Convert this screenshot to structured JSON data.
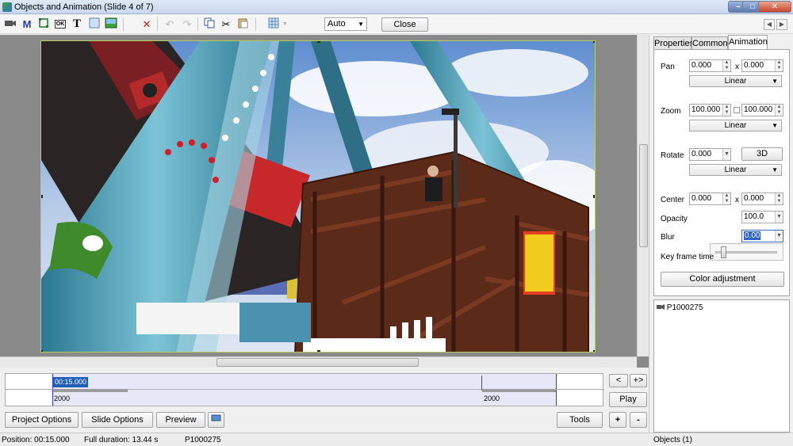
{
  "window": {
    "title": "Objects and Animation  (Slide 4 of 7)",
    "min_glyph": "–",
    "max_glyph": "□",
    "close_glyph": "✕"
  },
  "toolbar": {
    "zoom_value": "Auto",
    "close_label": "Close",
    "icons": [
      "camera-icon",
      "mask-icon",
      "frame-icon",
      "button-icon",
      "text-icon",
      "rectangle-icon",
      "image-icon",
      "delete-icon",
      "undo-icon",
      "redo-icon",
      "copy-icon",
      "cut-icon",
      "paste-icon",
      "grid-icon"
    ],
    "text_glyph": "T",
    "mask_glyph": "M",
    "button_glyph": "OK",
    "delete_glyph": "✕",
    "undo_glyph": "↶",
    "redo_glyph": "↷",
    "cut_glyph": "✂"
  },
  "tabs": [
    {
      "label": "Properties"
    },
    {
      "label": "Common"
    },
    {
      "label": "Animation"
    }
  ],
  "animation": {
    "pan": {
      "label": "Pan",
      "x": "0.000",
      "y": "0.000",
      "sep": "x",
      "mode": "Linear"
    },
    "zoom": {
      "label": "Zoom",
      "x": "100.000",
      "y": "100.000",
      "mode": "Linear"
    },
    "rotate": {
      "label": "Rotate",
      "value": "0.000",
      "btn3d": "3D",
      "mode": "Linear"
    },
    "center": {
      "label": "Center",
      "x": "0.000",
      "y": "0.000",
      "sep": "x"
    },
    "opacity": {
      "label": "Opacity",
      "value": "100.0"
    },
    "blur": {
      "label": "Blur",
      "value": "0.00"
    },
    "keyframe": {
      "label": "Key frame time",
      "slider_fraction": 0.1
    },
    "color_adjustment": "Color adjustment"
  },
  "objects_list": {
    "items": [
      {
        "name": "P1000275"
      }
    ]
  },
  "timeline": {
    "current_time": "00:15.000",
    "marker_left": "2000",
    "marker_right": "2000"
  },
  "nav": {
    "prev": "<",
    "next": "+>",
    "play": "Play",
    "add": "+",
    "remove": "-",
    "left_arrow": "◀",
    "right_arrow": "▶"
  },
  "buttons": {
    "project_options": "Project Options",
    "slide_options": "Slide Options",
    "preview": "Preview",
    "tools": "Tools"
  },
  "status": {
    "position": "Position:  00:15.000",
    "duration": "Full duration:  13.44 s",
    "object": "P1000275",
    "objects_count": "Objects (1)"
  },
  "colors": {
    "accent": "#1f5fb5",
    "timeline_range": "#e6e8f7",
    "frame_border": "#b6cf5c"
  }
}
